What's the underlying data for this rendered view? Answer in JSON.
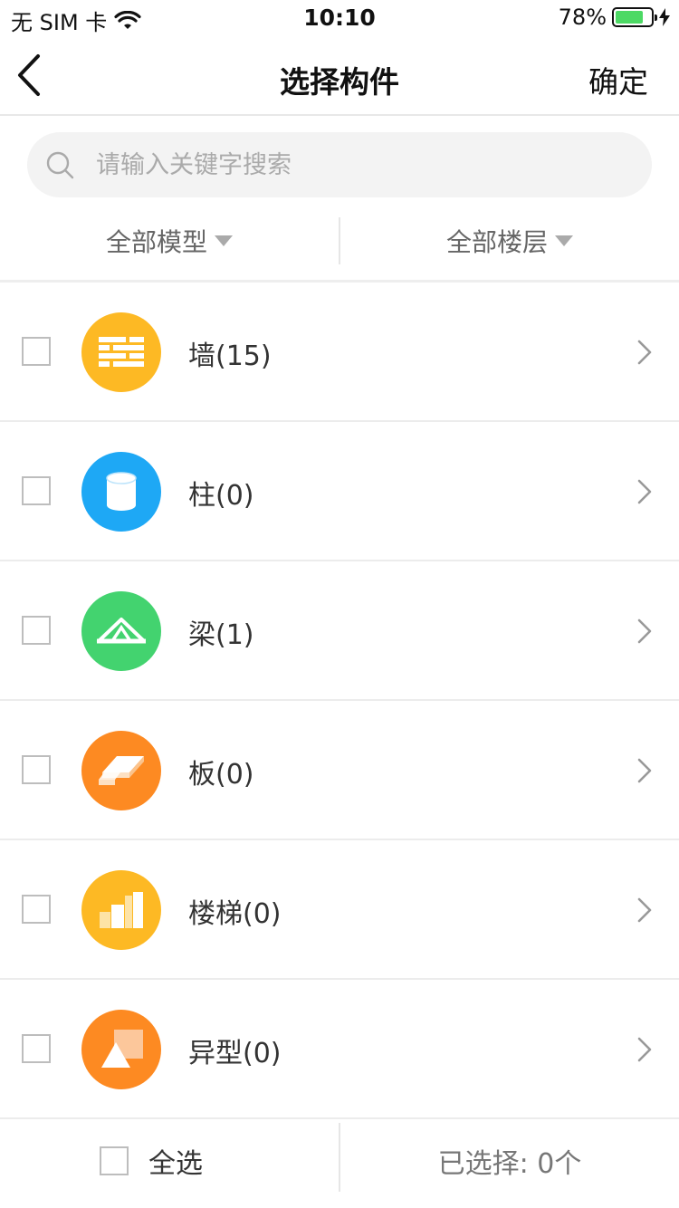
{
  "status_bar": {
    "carrier": "无 SIM 卡",
    "time": "10:10",
    "battery": "78%",
    "battery_level": 0.78
  },
  "nav": {
    "title": "选择构件",
    "confirm_label": "确定"
  },
  "search": {
    "placeholder": "请输入关键字搜索",
    "value": ""
  },
  "filters": {
    "model": "全部模型",
    "floor": "全部楼层"
  },
  "components": [
    {
      "label": "墙(15)",
      "icon": "wall-icon",
      "color": "#fdb924"
    },
    {
      "label": "柱(0)",
      "icon": "column-icon",
      "color": "#1ea8f5"
    },
    {
      "label": "梁(1)",
      "icon": "beam-icon",
      "color": "#43d36f"
    },
    {
      "label": "板(0)",
      "icon": "slab-icon",
      "color": "#fd8a22"
    },
    {
      "label": "楼梯(0)",
      "icon": "stairs-icon",
      "color": "#fdb924"
    },
    {
      "label": "异型(0)",
      "icon": "irregular-icon",
      "color": "#fd8a22"
    }
  ],
  "bottom": {
    "select_all_label": "全选",
    "selected_count": "已选择: 0个"
  }
}
